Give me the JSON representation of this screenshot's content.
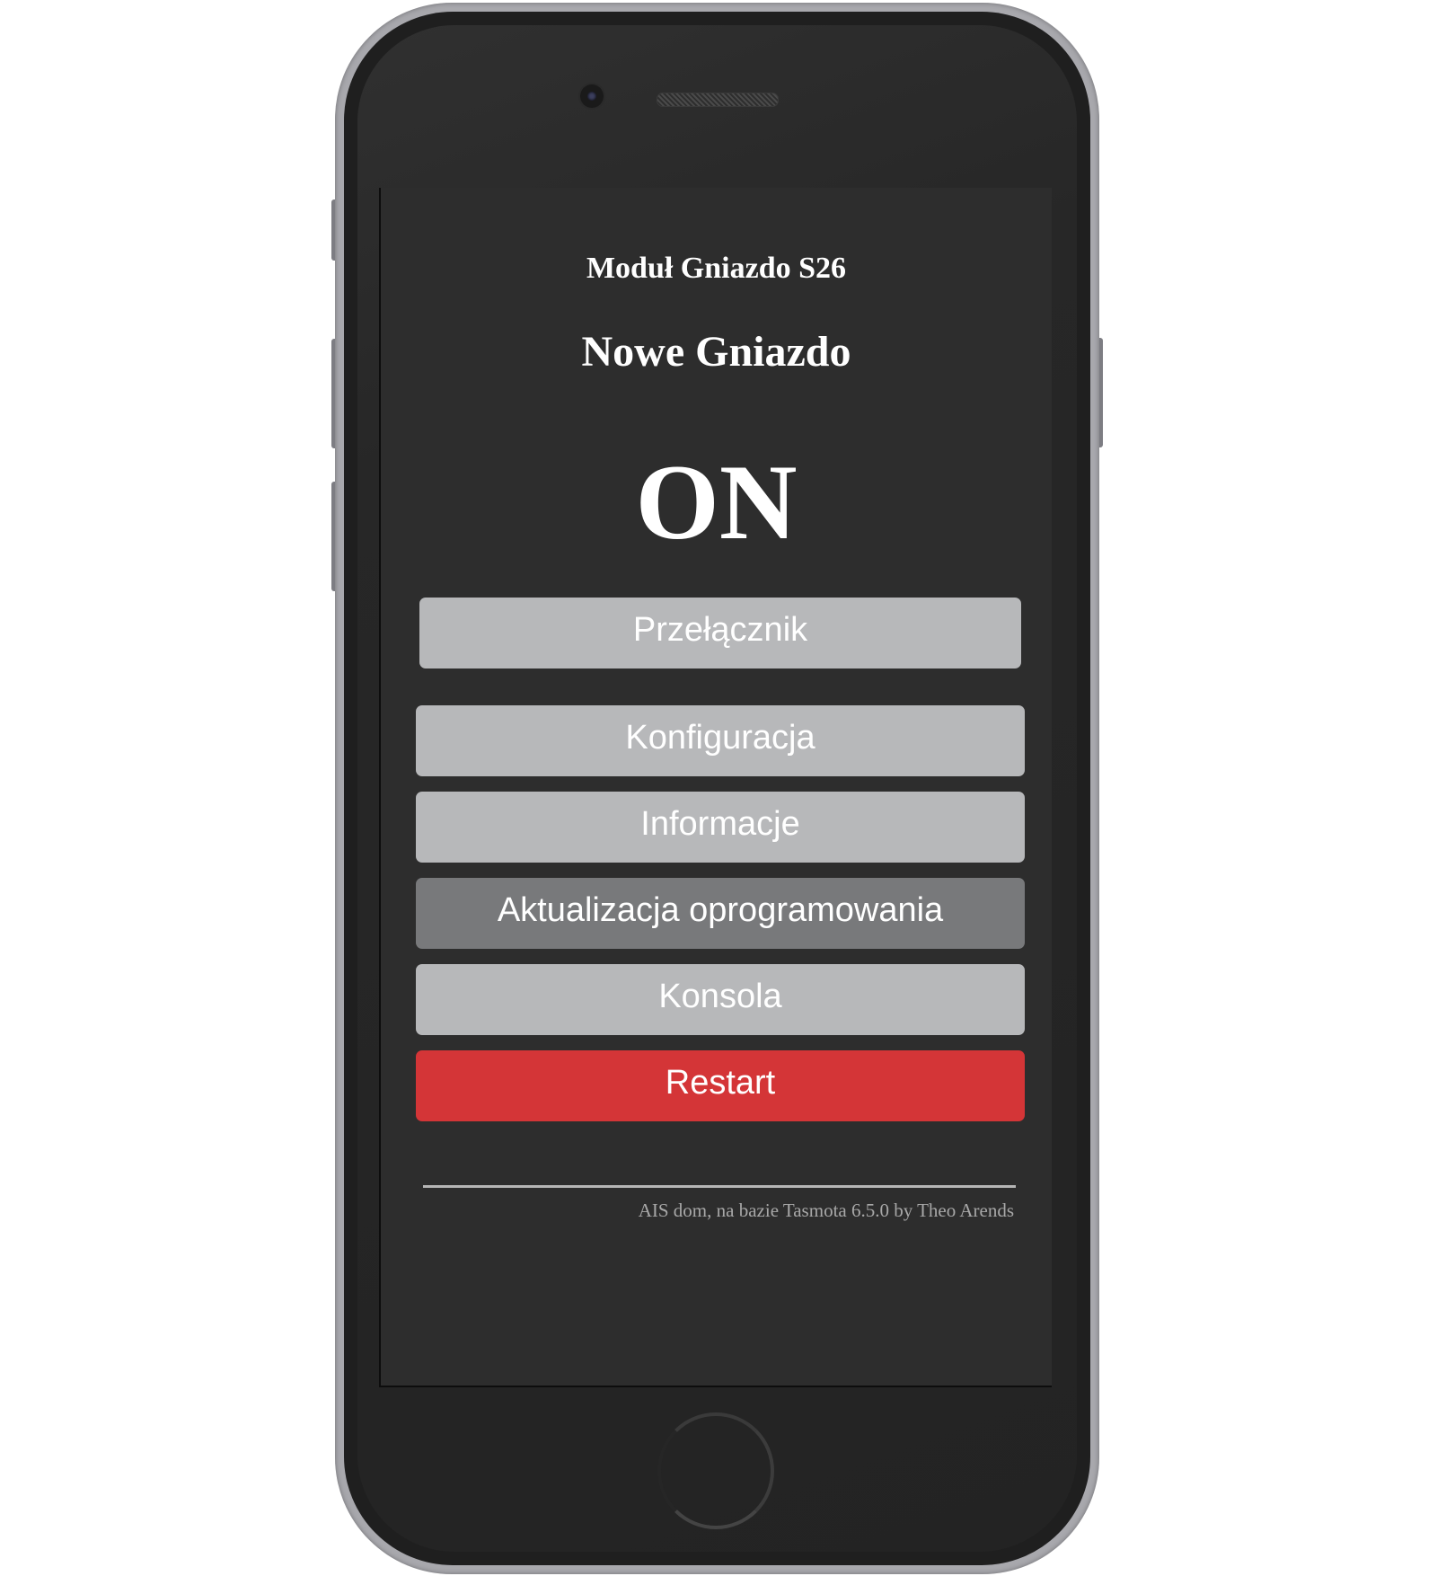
{
  "screen": {
    "module_title": "Moduł Gniazdo S26",
    "device_name": "Nowe Gniazdo",
    "state": "ON"
  },
  "buttons": {
    "toggle": "Przełącznik",
    "configuration": "Konfiguracja",
    "information": "Informacje",
    "firmware_update": "Aktualizacja oprogramowania",
    "console": "Konsola",
    "restart": "Restart"
  },
  "footer": {
    "text": "AIS dom, na bazie Tasmota 6.5.0 by Theo Arends"
  },
  "colors": {
    "screen_background": "#2d2d2d",
    "button_light": "#b7b8ba",
    "button_disabled": "#78797b",
    "button_danger": "#d43537",
    "phone_frame": "#a8a8ad"
  }
}
